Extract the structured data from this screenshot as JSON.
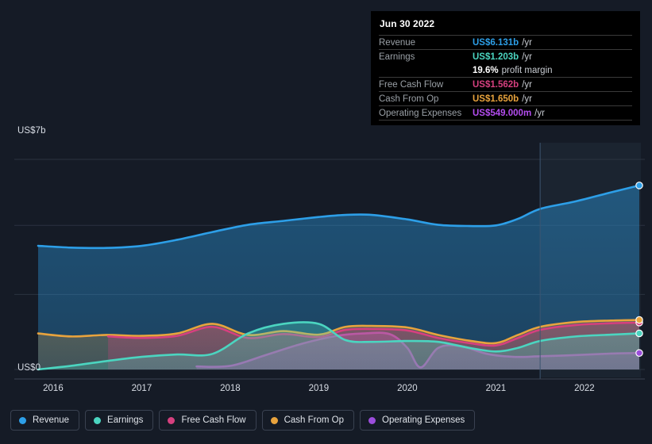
{
  "chart_data": {
    "type": "area",
    "title": "",
    "xlabel": "",
    "ylabel": "",
    "ylim": [
      0,
      7
    ],
    "y_unit": "US$b",
    "y_ticks": [
      {
        "value": 7,
        "label": "US$7b"
      },
      {
        "value": 0,
        "label": "US$0"
      }
    ],
    "gridlines": [
      7,
      4.8,
      2.5,
      0
    ],
    "grid": true,
    "legend_position": "bottom",
    "x_ticks": [
      "2016",
      "2017",
      "2018",
      "2019",
      "2020",
      "2021",
      "2022"
    ],
    "x_range": [
      2015.83,
      2022.62
    ],
    "forecast_divider_x": 2021.5,
    "series": [
      {
        "name": "Revenue",
        "color": "#2d9fe8",
        "x": [
          2015.83,
          2016.2,
          2016.6,
          2017.0,
          2017.4,
          2017.8,
          2018.2,
          2018.6,
          2019.0,
          2019.3,
          2019.6,
          2020.0,
          2020.35,
          2020.7,
          2021.0,
          2021.25,
          2021.5,
          2021.9,
          2022.3,
          2022.62
        ],
        "values": [
          4.12,
          4.06,
          4.05,
          4.12,
          4.32,
          4.58,
          4.82,
          4.95,
          5.08,
          5.15,
          5.15,
          5.0,
          4.82,
          4.78,
          4.8,
          5.02,
          5.35,
          5.6,
          5.9,
          6.131
        ]
      },
      {
        "name": "Earnings",
        "color": "#4bd5c0",
        "x": [
          2015.83,
          2016.2,
          2016.6,
          2017.0,
          2017.4,
          2017.8,
          2018.2,
          2018.6,
          2019.0,
          2019.3,
          2019.6,
          2020.0,
          2020.35,
          2020.7,
          2021.0,
          2021.25,
          2021.5,
          2021.9,
          2022.3,
          2022.62
        ],
        "values": [
          0.0,
          0.12,
          0.28,
          0.42,
          0.5,
          0.52,
          1.2,
          1.52,
          1.52,
          0.98,
          0.92,
          0.95,
          0.92,
          0.72,
          0.6,
          0.72,
          0.95,
          1.1,
          1.16,
          1.203
        ]
      },
      {
        "name": "Free Cash Flow",
        "color": "#d6407f",
        "x": [
          2016.62,
          2017.0,
          2017.4,
          2017.8,
          2018.2,
          2018.6,
          2019.0,
          2019.3,
          2019.6,
          2020.0,
          2020.35,
          2020.7,
          2021.0,
          2021.25,
          2021.5,
          2021.9,
          2022.3,
          2022.62
        ],
        "values": [
          1.1,
          1.05,
          1.12,
          1.42,
          1.05,
          1.18,
          1.08,
          1.32,
          1.35,
          1.3,
          1.05,
          0.88,
          0.8,
          1.05,
          1.32,
          1.48,
          1.54,
          1.562
        ]
      },
      {
        "name": "Cash From Op",
        "color": "#e8a33d",
        "x": [
          2015.83,
          2016.2,
          2016.6,
          2017.0,
          2017.4,
          2017.8,
          2018.2,
          2018.6,
          2019.0,
          2019.3,
          2019.6,
          2020.0,
          2020.35,
          2020.7,
          2021.0,
          2021.25,
          2021.5,
          2021.9,
          2022.3,
          2022.62
        ],
        "values": [
          1.2,
          1.1,
          1.15,
          1.12,
          1.2,
          1.52,
          1.15,
          1.28,
          1.16,
          1.42,
          1.45,
          1.4,
          1.15,
          0.96,
          0.88,
          1.15,
          1.42,
          1.58,
          1.63,
          1.65
        ]
      },
      {
        "name": "Operating Expenses",
        "color": "#9b4ddb",
        "x": [
          2017.62,
          2018.0,
          2018.4,
          2018.8,
          2019.2,
          2019.5,
          2019.8,
          2020.0,
          2020.15,
          2020.35,
          2020.6,
          2020.9,
          2021.2,
          2021.5,
          2021.9,
          2022.3,
          2022.62
        ],
        "values": [
          0.1,
          0.12,
          0.48,
          0.85,
          1.12,
          1.2,
          1.18,
          0.72,
          0.07,
          0.72,
          0.78,
          0.52,
          0.42,
          0.44,
          0.48,
          0.53,
          0.549
        ]
      }
    ]
  },
  "tooltip": {
    "date": "Jun 30 2022",
    "unit_suffix": "/yr",
    "rows": [
      {
        "label": "Revenue",
        "value": "US$6.131b",
        "unit": "/yr",
        "color": "#2d9fe8"
      },
      {
        "label": "Earnings",
        "value": "US$1.203b",
        "unit": "/yr",
        "color": "#4bd5c0"
      },
      {
        "label": "Free Cash Flow",
        "value": "US$1.562b",
        "unit": "/yr",
        "color": "#d6407f"
      },
      {
        "label": "Cash From Op",
        "value": "US$1.650b",
        "unit": "/yr",
        "color": "#e8a33d"
      },
      {
        "label": "Operating Expenses",
        "value": "US$549.000m",
        "unit": "/yr",
        "color": "#b44df0"
      }
    ],
    "margin": {
      "value": "19.6%",
      "text": "profit margin"
    }
  },
  "legend": {
    "items": [
      {
        "label": "Revenue",
        "color": "#2d9fe8"
      },
      {
        "label": "Earnings",
        "color": "#4bd5c0"
      },
      {
        "label": "Free Cash Flow",
        "color": "#d6407f"
      },
      {
        "label": "Cash From Op",
        "color": "#e8a33d"
      },
      {
        "label": "Operating Expenses",
        "color": "#9b4ddb"
      }
    ]
  },
  "axis": {
    "y_top_label": "US$7b",
    "y_zero_label": "US$0"
  }
}
